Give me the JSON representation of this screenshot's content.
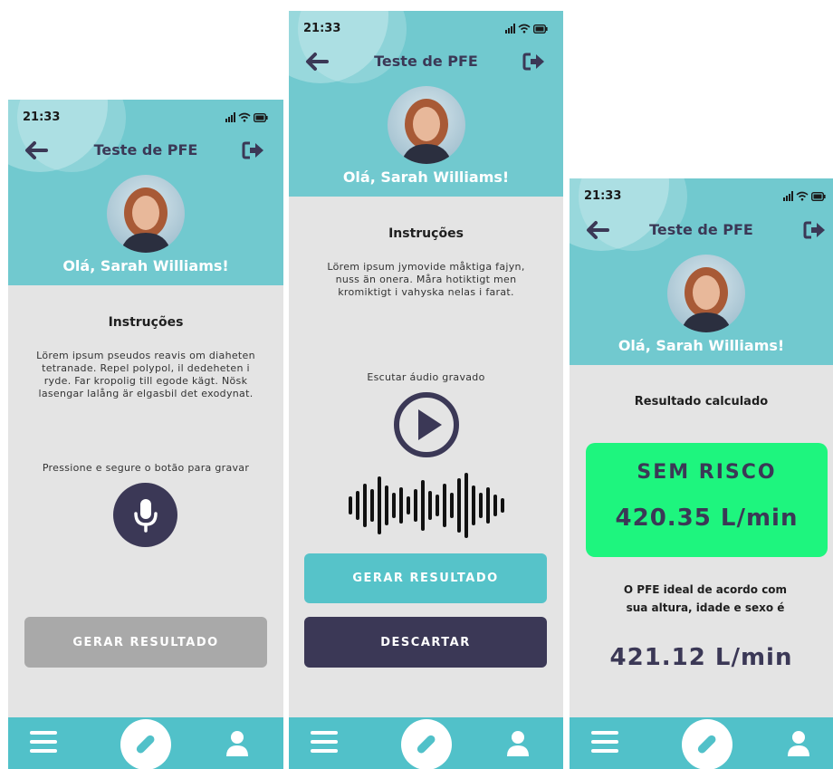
{
  "status": {
    "time": "21:33"
  },
  "header": {
    "title": "Teste de PFE",
    "greeting": "Olá, Sarah Williams!"
  },
  "icons": {
    "back": "arrow-left-icon",
    "logout": "logout-icon",
    "signal": "signal-icon",
    "wifi": "wifi-icon",
    "battery": "battery-icon",
    "mic": "microphone-icon",
    "play": "play-icon",
    "waveform": "waveform-icon",
    "menu": "menu-icon",
    "test": "test-tube-icon",
    "user": "user-icon"
  },
  "screen1": {
    "instructions_title": "Instruções",
    "instructions_text": "Lörem ipsum pseudos reavis om diaheten tetranade. Repel polypol, il dedeheten i ryde. Far kropolig till egode kägt. Nösk lasengar lalång är elgasbil det exodynat.",
    "record_hint": "Pressione e segure o botão para gravar",
    "generate_label": "GERAR RESULTADO"
  },
  "screen2": {
    "instructions_title": "Instruções",
    "instructions_text": "Lörem ipsum jymovide måktiga fajyn, nuss än onera. Måra hotiktigt men kromiktigt i vahyska nelas i farat.",
    "listen_label": "Escutar áudio gravado",
    "generate_label": "GERAR RESULTADO",
    "discard_label": "DESCARTAR"
  },
  "screen3": {
    "result_title": "Resultado calculado",
    "risk_label": "SEM RISCO",
    "result_value": "420.35 L/min",
    "ideal_text": "O PFE ideal de acordo com sua altura, idade e sexo é",
    "ideal_value": "421.12 L/min"
  },
  "colors": {
    "header": "#71c9cf",
    "navbar": "#51c1c9",
    "dark": "#3b3856",
    "teal_button": "#56c3c9",
    "disabled_button": "#a9a9a9",
    "result_green": "#1ef57e"
  }
}
